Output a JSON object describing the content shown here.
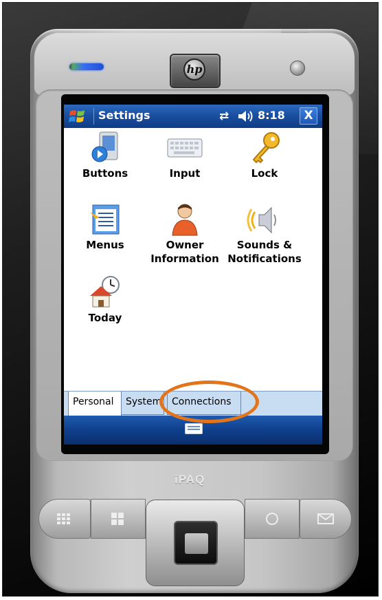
{
  "window": {
    "title": "Settings",
    "time": "8:18",
    "close_label": "X",
    "connectivity_icon": "connectivity-icon",
    "volume_icon": "speaker-icon"
  },
  "settings_items": [
    {
      "label": "Buttons",
      "icon": "buttons-icon"
    },
    {
      "label": "Input",
      "icon": "keyboard-icon"
    },
    {
      "label": "Lock",
      "icon": "key-icon"
    },
    {
      "label": "Menus",
      "icon": "menus-icon"
    },
    {
      "label": "Owner\nInformation",
      "icon": "owner-icon"
    },
    {
      "label": "Sounds &\nNotifications",
      "icon": "sounds-icon"
    },
    {
      "label": "Today",
      "icon": "today-icon"
    }
  ],
  "tabs": [
    {
      "label": "Personal",
      "active": true
    },
    {
      "label": "System",
      "active": false
    },
    {
      "label": "Connections",
      "active": false
    }
  ],
  "device": {
    "brand_logo": "hp",
    "model_logo": "iPAQ"
  },
  "colors": {
    "highlight": "#e2741b",
    "titlebar": "#1a4fa0",
    "tabstrip": "#c8dcf2"
  }
}
